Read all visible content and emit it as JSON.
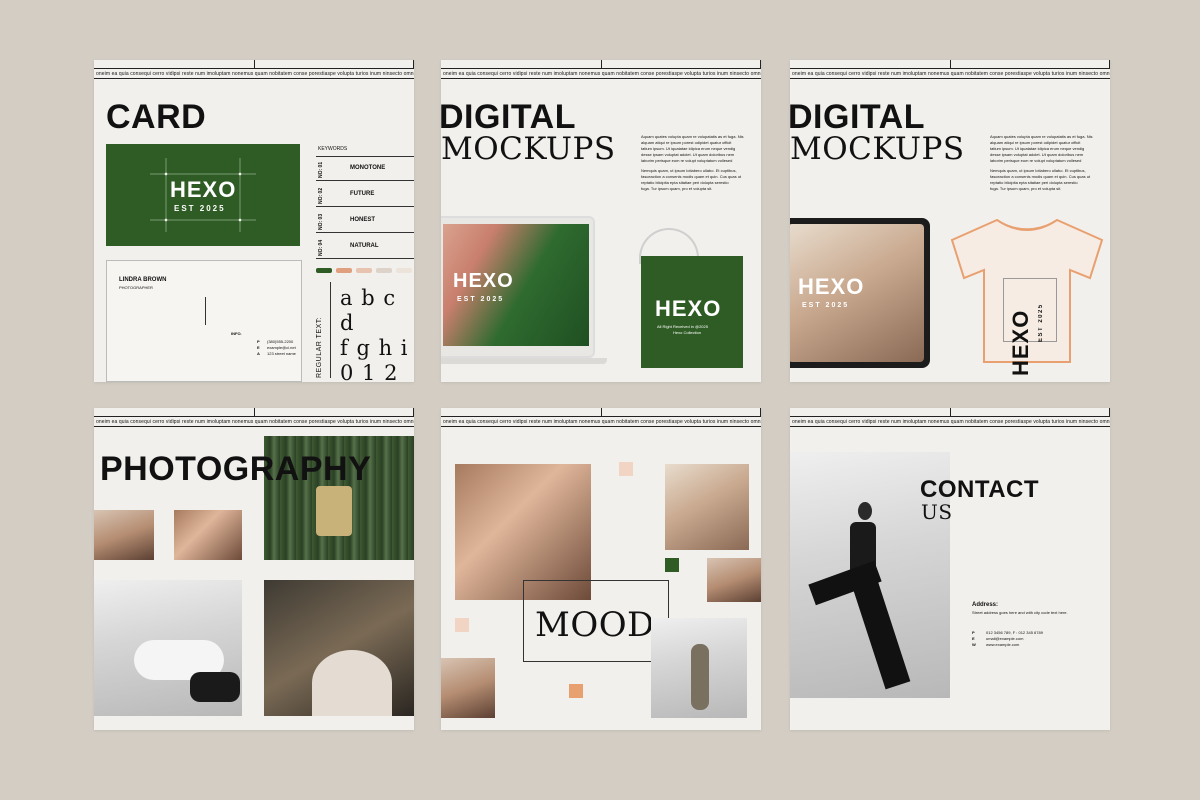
{
  "ticker_text": "oneim ea quia consequi cerro vidipsi reste num imoluptam nonemus quam nobitatem conse porestiaspe volupta turios inum ninsecto omnimoleim ea quia consequi cerro videst reste num imoluptam nonemus",
  "card1": {
    "title": "CARD",
    "logo": "HEXO",
    "logo_sub": "EST 2025",
    "keywords_header": "KEYWORDS",
    "keywords": [
      {
        "num": "NO: 01",
        "label": "MONOTONE"
      },
      {
        "num": "NO: 02",
        "label": "FUTURE"
      },
      {
        "num": "NO: 03",
        "label": "HONEST"
      },
      {
        "num": "NO: 04",
        "label": "NATURAL"
      }
    ],
    "business_card": {
      "name": "LINDRA BROWN",
      "role": "PHOTOGRAPHER",
      "info_label": "INFO.",
      "lines": [
        "(380)555-2200",
        "example@ci.net",
        "123 street name"
      ],
      "letters": [
        "P",
        "E",
        "A"
      ]
    },
    "swatch_colors": [
      "#2e5c24",
      "#e0a080",
      "#e8c4b0",
      "#ddd3c8",
      "#ece4da"
    ],
    "regular_text_label": "REGULAR TEXT:",
    "type_specimen": [
      "a b c d",
      "f g h i",
      "0 1 2 %"
    ]
  },
  "card2": {
    "title_bold": "DIGITAL",
    "title_serif": "MOCKUPS",
    "body": [
      "Aquam quates volupta quam re volupatatis as et fuga. Nis",
      "alquam atiqui re ipsum porest odipidet quatur officit",
      "tatium ipsum. Ut iquatatae idipica erum neque vendig",
      "desse ipsam voluptat adolet. Ut quam doloribus nem",
      "laborim perisque eum re volupt voluptatum vollesed",
      "Nemquis quam, ut ipsum lotiabero ullabo. Et cuptibus,",
      "fasceaction a consenis modis quam et quin. Cus quas ut",
      "reptatio blicipita epta sitatiae peri dolupta serestio",
      "fuga. Tur ipsum quam, pro et volupta sit."
    ],
    "laptop_logo": "HEXO",
    "laptop_sub": "EST 2025",
    "bag_logo": "HEXO",
    "bag_lines": [
      "All Right Received in @2025",
      "Hexo Collection"
    ]
  },
  "card3": {
    "title_bold": "DIGITAL",
    "title_serif": "MOCKUPS",
    "body": [
      "Aquam quates volupta quam re volupatatis as et fuga. Nis",
      "alquam atiqui re ipsum porest odipidet quatur officit",
      "tatium ipsum. Ut iquatatae idipica erum neque vendig",
      "desse ipsam voluptat adolet. Ut quam doloribus nem",
      "laborim perisque eum re volupt voluptatum vollesed",
      "Nemquis quam, ut ipsum lotiabero ullabo. Et cuptibus,",
      "fasceaction a consenis modis quam et quin. Cus quas ut",
      "reptatio blicipita epta sitatiae peri dolupta serestio",
      "fuga. Tur ipsum quam, pro et volupta sit."
    ],
    "tablet_logo": "HEXO",
    "tablet_sub": "EST 2025",
    "shirt_logo": "HEXO",
    "shirt_sub": "EST 2025",
    "shirt_color": "#e8a070"
  },
  "card4": {
    "title": "PHOTOGRAPHY"
  },
  "card5": {
    "word": "MOOD",
    "accent_colors": [
      "#f2d4c4",
      "#2e5c24",
      "#e8a070"
    ]
  },
  "card6": {
    "title_bold": "CONTACT",
    "title_serif": "US",
    "address_label": "Address:",
    "address_text": "Street address goes here and with city code text here.",
    "rows": [
      {
        "k": "P",
        "v": "012 3456 789, F : 012 345 6789"
      },
      {
        "k": "E",
        "v": "umail@example.com"
      },
      {
        "k": "W",
        "v": "www.example.com"
      }
    ]
  }
}
